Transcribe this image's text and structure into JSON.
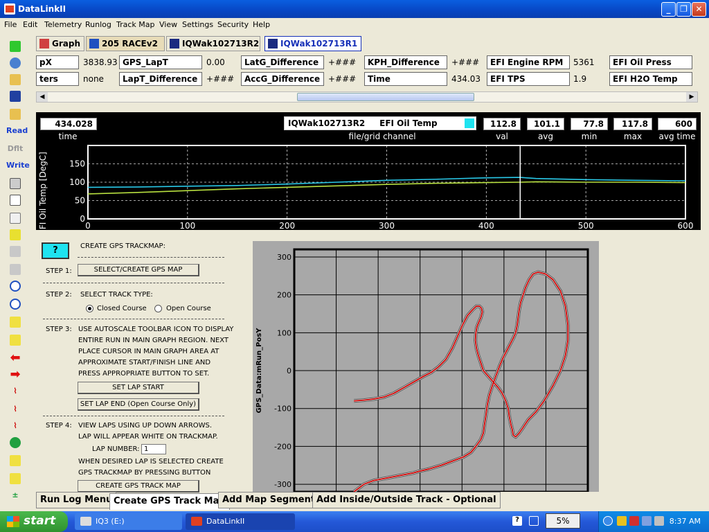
{
  "window": {
    "title": "DataLinkII",
    "min_btn": "_",
    "max_btn": "❐",
    "close_btn": "✕"
  },
  "menu": [
    "File",
    "Edit",
    "Telemetry",
    "Runlog",
    "Track Map",
    "View",
    "Settings",
    "Security",
    "Help"
  ],
  "toolbar_left": {
    "read": "Read",
    "dflt": "Dflt",
    "write": "Write"
  },
  "tabs": [
    "Graph",
    "205 RACEv2",
    "IQWak102713R2",
    "IQWak102713R1"
  ],
  "channels": {
    "row1": [
      {
        "name": "pX",
        "value": "3838.93"
      },
      {
        "name": "GPS_LapT",
        "value": "0.00"
      },
      {
        "name": "LatG_Difference",
        "value": "+###"
      },
      {
        "name": "KPH_Difference",
        "value": "+###"
      },
      {
        "name": "EFI Engine RPM",
        "value": "5361"
      },
      {
        "name": "EFI Oil Press",
        "value": ""
      }
    ],
    "row2": [
      {
        "name": "ters",
        "value": "none"
      },
      {
        "name": "LapT_Difference",
        "value": "+###"
      },
      {
        "name": "AccG_Difference",
        "value": "+###"
      },
      {
        "name": "Time",
        "value": "434.03"
      },
      {
        "name": "EFI TPS",
        "value": "1.9"
      },
      {
        "name": "EFI H2O Temp",
        "value": ""
      }
    ]
  },
  "readout": {
    "time_value": "434.028",
    "time_label": "time",
    "channel_file": "IQWak102713R2",
    "channel_name": "EFI Oil Temp",
    "channel_label": "file/grid channel",
    "channel_color": "#1ee3f0",
    "val": "112.8",
    "val_label": "val",
    "avg": "101.1",
    "avg_label": "avg",
    "min": "77.8",
    "min_label": "min",
    "max": "117.8",
    "max_label": "max",
    "avgtime": "600",
    "avgtime_label": "avg time"
  },
  "chart_data": [
    {
      "type": "line",
      "title": "",
      "xlabel": "",
      "ylabel": "EFI Oil Temp [DegC]",
      "xlim": [
        0,
        600
      ],
      "ylim": [
        0,
        200
      ],
      "x_ticks": [
        "0",
        "100",
        "200",
        "300",
        "400",
        "500",
        "600"
      ],
      "y_ticks": [
        "0",
        "50",
        "100",
        "150"
      ],
      "cursor_x": 434.028,
      "series": [
        {
          "color": "#29c8e8",
          "x": [
            0,
            50,
            100,
            150,
            200,
            250,
            300,
            350,
            400,
            434,
            450,
            500,
            550,
            590,
            600
          ],
          "y": [
            86,
            87,
            89,
            91,
            95,
            100,
            105,
            108,
            112,
            113,
            110,
            107,
            105,
            104,
            104
          ]
        },
        {
          "color": "#b8e040",
          "x": [
            0,
            50,
            100,
            150,
            200,
            250,
            300,
            350,
            400,
            434,
            450,
            500,
            550,
            600
          ],
          "y": [
            68,
            72,
            77,
            82,
            86,
            90,
            94,
            97,
            99,
            100,
            101,
            100,
            100,
            99
          ]
        }
      ]
    },
    {
      "type": "line",
      "title": "",
      "xlabel": "",
      "ylabel": "GPS_Data:mRun_PosY",
      "ylim": [
        -320,
        320
      ],
      "y_ticks": [
        "300",
        "200",
        "100",
        "0",
        "-100",
        "-200",
        "-300"
      ],
      "series": [
        {
          "color": "#cc0000",
          "x": [
            -160,
            -140,
            -120,
            -100,
            -80,
            -60,
            -40,
            -30,
            -10,
            15,
            40,
            60,
            75,
            85,
            95,
            100,
            102,
            105,
            108,
            112,
            118,
            125,
            132,
            140,
            150,
            160,
            165,
            168,
            170,
            172,
            175,
            180,
            185,
            192,
            200,
            210,
            225,
            240,
            255,
            265,
            270,
            270,
            265,
            255,
            240,
            222,
            205,
            190,
            180,
            172,
            165,
            160,
            158,
            155,
            152,
            150,
            145,
            138,
            130,
            120,
            110,
            100,
            95,
            90,
            86,
            84,
            85,
            87,
            90,
            95,
            98,
            96,
            92,
            86,
            78,
            68,
            58,
            48,
            38,
            25,
            10,
            -5,
            -20,
            -40,
            -60,
            -80,
            -100,
            -120,
            -140,
            -160
          ],
          "y": [
            -320,
            -300,
            -290,
            -285,
            -280,
            -275,
            -270,
            -266,
            -260,
            -250,
            -238,
            -228,
            -216,
            -200,
            -182,
            -165,
            -145,
            -120,
            -90,
            -65,
            -40,
            -15,
            10,
            35,
            60,
            85,
            100,
            120,
            140,
            160,
            180,
            200,
            220,
            240,
            255,
            260,
            255,
            240,
            210,
            170,
            120,
            80,
            40,
            0,
            -40,
            -80,
            -110,
            -130,
            -150,
            -165,
            -175,
            -170,
            -155,
            -140,
            -120,
            -100,
            -80,
            -60,
            -45,
            -30,
            -15,
            0,
            20,
            40,
            60,
            80,
            100,
            115,
            125,
            140,
            155,
            165,
            170,
            170,
            160,
            145,
            120,
            90,
            60,
            30,
            10,
            -5,
            -15,
            -30,
            -45,
            -60,
            -70,
            -75,
            -78,
            -80
          ],
          "note_x": [
            0
          ]
        }
      ]
    }
  ],
  "trackmap": {
    "help_label": "?",
    "title": "CREATE GPS TRACKMAP:",
    "step1_label": "STEP 1:",
    "step1_button": "SELECT/CREATE  GPS MAP",
    "step2_label": "STEP 2:",
    "step2_text": "SELECT TRACK TYPE:",
    "closed_course": "Closed Course",
    "open_course": "Open Course",
    "step3_label": "STEP 3:",
    "step3_lines": [
      "USE AUTOSCALE TOOLBAR ICON TO DISPLAY",
      "ENTIRE RUN IN MAIN GRAPH REGION. NEXT",
      "PLACE CURSOR IN MAIN GRAPH AREA AT",
      "APPROXIMATE START/FINISH LINE  AND",
      "PRESS APPROPRIATE BUTTON TO SET."
    ],
    "set_lap_start": "SET LAP START",
    "set_lap_end": "SET LAP END (Open Course Only)",
    "step4_label": "STEP 4:",
    "step4_lines": [
      "VIEW LAPS USING UP DOWN ARROWS.",
      "LAP WILL APPEAR WHITE ON TRACKMAP."
    ],
    "lap_number_label": "LAP NUMBER:",
    "lap_number": "1",
    "step4b_lines": [
      "WHEN DESIRED LAP IS SELECTED CREATE",
      "GPS TRACKMAP BY PRESSING BUTTON"
    ],
    "create_button": "CREATE GPS TRACK MAP"
  },
  "bottom_tabs": [
    "Run Log Menu",
    "Create GPS Track Map",
    "Add Map Segments",
    "Add Inside/Outside Track - Optional"
  ],
  "taskbar": {
    "start": "start",
    "task1": "IQ3 (E:)",
    "task2": "DataLinkII",
    "cpu": "5%",
    "clock": "8:37 AM"
  }
}
